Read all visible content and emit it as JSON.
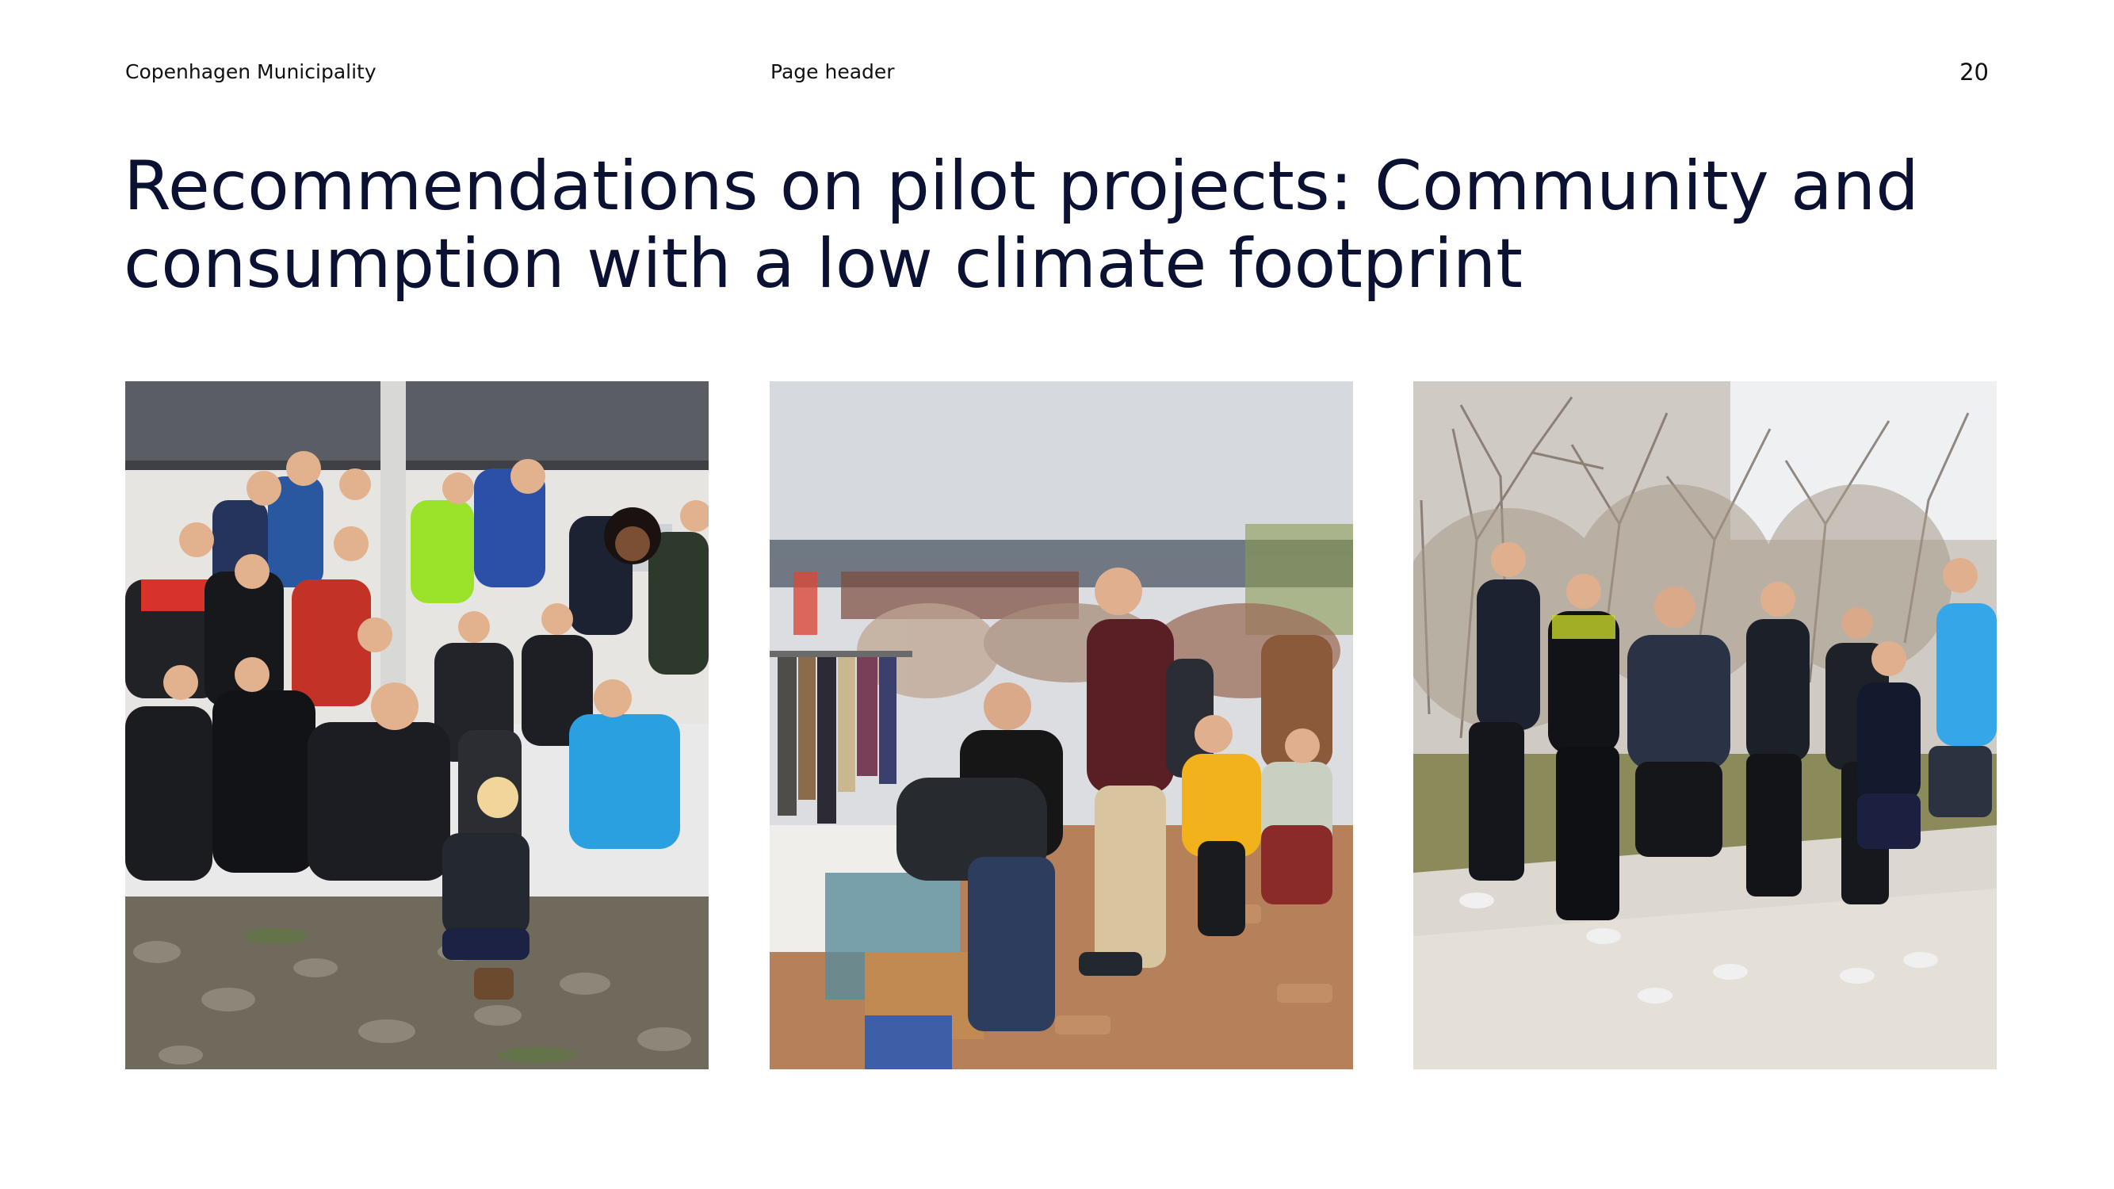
{
  "header": {
    "organization": "Copenhagen Municipality",
    "section": "Page header",
    "page_number": "20"
  },
  "title": "Recommendations on pilot projects: Community and consumption with a low climate footprint",
  "photos": [
    {
      "subject": "group-of-runners-photo"
    },
    {
      "subject": "flea-market-photo"
    },
    {
      "subject": "running-event-photo"
    }
  ]
}
